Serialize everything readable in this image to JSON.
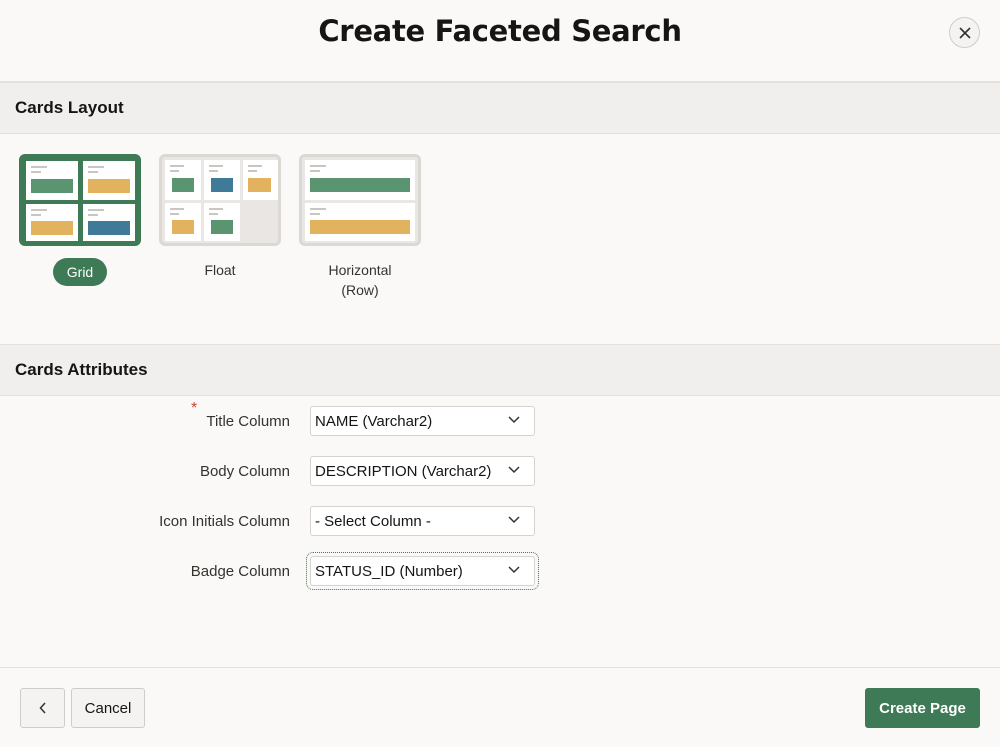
{
  "dialog": {
    "title": "Create Faceted Search",
    "close_icon": "close-icon"
  },
  "cards_layout": {
    "heading": "Cards Layout",
    "selected": "Grid",
    "options": [
      {
        "label": "Grid"
      },
      {
        "label": "Float"
      },
      {
        "label": "Horizontal (Row)"
      }
    ]
  },
  "cards_attributes": {
    "heading": "Cards Attributes",
    "fields": [
      {
        "label": "Title Column",
        "required": true,
        "value": "NAME (Varchar2)"
      },
      {
        "label": "Body Column",
        "required": false,
        "value": "DESCRIPTION (Varchar2)"
      },
      {
        "label": "Icon Initials Column",
        "required": false,
        "value": "- Select Column -"
      },
      {
        "label": "Badge Column",
        "required": false,
        "value": "STATUS_ID (Number)"
      }
    ]
  },
  "footer": {
    "back_icon": "chevron-left-icon",
    "cancel_label": "Cancel",
    "create_label": "Create Page"
  },
  "colors": {
    "accent": "#3d7a55",
    "required": "#c74634"
  }
}
